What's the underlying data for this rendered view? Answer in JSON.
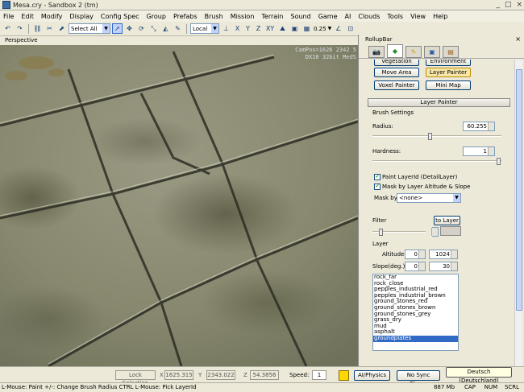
{
  "window": {
    "title": "Mesa.cry - Sandbox 2 (tm)",
    "controls": [
      "_",
      "□",
      "×"
    ]
  },
  "menu": [
    "File",
    "Edit",
    "Modify",
    "Display",
    "Config Spec",
    "Group",
    "Prefabs",
    "Brush",
    "Mission",
    "Terrain",
    "Sound",
    "Game",
    "AI",
    "Clouds",
    "Tools",
    "View",
    "Help"
  ],
  "toolbar": {
    "select_mode": "Select All",
    "coord_system": "Local",
    "axes": [
      "X",
      "Y",
      "Z",
      "XY"
    ],
    "snap_value": "0.25"
  },
  "viewport": {
    "label": "Perspective",
    "cam_line1": "CamPos=1626 2342  5",
    "cam_line2": "DX10 32bit MedS"
  },
  "rollup": {
    "title": "RollupBar",
    "close": "×",
    "buttons": {
      "vegetation": "Vegetation",
      "environment": "Environment",
      "move_area": "Move Area",
      "layer_painter": "Layer Painter",
      "voxel_painter": "Voxel Painter",
      "mini_map": "Mini Map"
    },
    "section_title": "Layer Painter",
    "brush_settings": "Brush Settings",
    "radius_label": "Radius:",
    "radius_value": "60.255",
    "radius_fraction": 0.45,
    "hardness_label": "Hardness:",
    "hardness_value": "1",
    "hardness_fraction": 1.0,
    "chk_paint_layer": "Paint LayerId (DetailLayer)",
    "chk_mask_altitude": "Mask by Layer Altitude & Slope",
    "mask_by_label": "Mask by",
    "mask_by_value": "<none>",
    "filter_label": "Filter",
    "to_layer": "to Layer",
    "filter_value": "1",
    "layer_label": "Layer",
    "altitude_label": "Altitude",
    "altitude_min": "0",
    "altitude_max": "1024",
    "slope_label": "Slope(deg.)",
    "slope_min": "0",
    "slope_max": "30",
    "layers": [
      "rock_far",
      "rock_close",
      "pepples_industrial_red",
      "pepples_industrial_brown",
      "ground_stones_red",
      "ground_stones_brown",
      "ground_stones_grey",
      "grass_dry",
      "mud",
      "asphalt",
      "groundplates"
    ],
    "selected_layer": "groundplates"
  },
  "status": {
    "lock_selection": "Lock Selection",
    "x_label": "X",
    "x_value": "1625.315",
    "y_label": "Y",
    "y_value": "2343.022",
    "z_label": "Z",
    "z_value": "54.3856",
    "speed_label": "Speed:",
    "speed_value": "1",
    "ai_physics": "AI/Physics",
    "no_sync": "No Sync Player",
    "tooltip": "Deutsch (Deutschland)",
    "hint": "L-Mouse: Paint   +/-: Change Brush Radius   CTRL L-Mouse: Pick LayerId",
    "memory": "887 Mb",
    "cap": "CAP",
    "num": "NUM",
    "scrl": "SCRL"
  }
}
